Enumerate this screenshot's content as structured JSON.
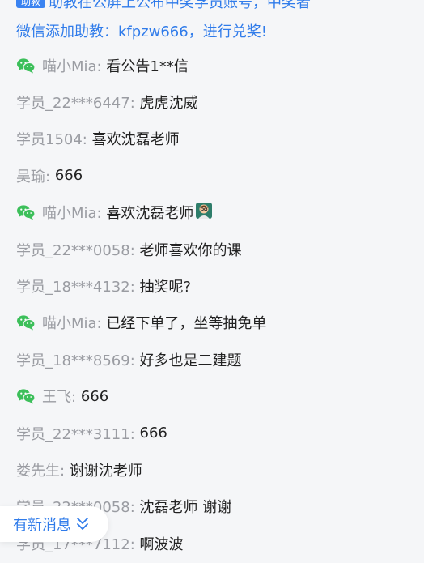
{
  "announcement": {
    "tag": "助教",
    "line1": "助教在公屏上公布中奖学员账号，中奖者",
    "line2": "微信添加助教：kfpzw666，进行兑奖!"
  },
  "messages": [
    {
      "wechat": true,
      "name": "喵小Mia:",
      "text": "看公告1**信"
    },
    {
      "wechat": false,
      "name": "学员_22***6447:",
      "text": "虎虎沈威"
    },
    {
      "wechat": false,
      "name": "学员1504:",
      "text": "喜欢沈磊老师"
    },
    {
      "wechat": false,
      "name": "吴瑜:",
      "text": "666"
    },
    {
      "wechat": true,
      "name": "喵小Mia:",
      "text": "喜欢沈磊老师",
      "emoji": "teacher-emoji"
    },
    {
      "wechat": false,
      "name": "学员_22***0058:",
      "text": "老师喜欢你的课"
    },
    {
      "wechat": false,
      "name": "学员_18***4132:",
      "text": "抽奖呢?"
    },
    {
      "wechat": true,
      "name": "喵小Mia:",
      "text": "已经下单了，坐等抽免单"
    },
    {
      "wechat": false,
      "name": "学员_18***8569:",
      "text": "好多也是二建题"
    },
    {
      "wechat": true,
      "name": "王飞:",
      "text": "666"
    },
    {
      "wechat": false,
      "name": "学员_22***3111:",
      "text": "666"
    },
    {
      "wechat": false,
      "name": "娄先生:",
      "text": "谢谢沈老师"
    },
    {
      "wechat": false,
      "name": "学员_22***0058:",
      "text": "沈磊老师 谢谢"
    },
    {
      "wechat": false,
      "name": "学员_17***7112:",
      "text": "啊波波"
    }
  ],
  "new_messages_button": {
    "label": "有新消息",
    "icon": "double-chevron-down-icon"
  },
  "colors": {
    "accent": "#2f7bea",
    "name": "#9a9ca2",
    "text": "#222222",
    "wechat": "#3cbf5a",
    "background": "#f5f6f8"
  }
}
